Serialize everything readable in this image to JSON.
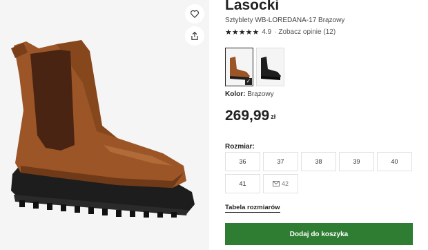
{
  "product": {
    "brand": "Lasocki",
    "name": "Sztyblety WB-LOREDANA-17 Brązowy",
    "rating_stars": "★★★★★",
    "rating_value": "4.9",
    "reviews_link": "· Zobacz opinie (12)",
    "color_label": "Kolor:",
    "color_value": "Brązowy",
    "price": "269,99",
    "currency": "zł"
  },
  "variants": [
    {
      "name": "brown",
      "selected": true,
      "check": "✓"
    },
    {
      "name": "black",
      "selected": false
    }
  ],
  "sizes": {
    "label": "Rozmiar:",
    "options": [
      "36",
      "37",
      "38",
      "39",
      "40",
      "41",
      "42"
    ],
    "notify_icon": "mail-icon"
  },
  "links": {
    "size_table": "Tabela rozmiarów"
  },
  "actions": {
    "add_to_cart": "Dodaj do koszyka"
  },
  "colors": {
    "accent_green": "#2e7d32",
    "boot_brown": "#8b4a22"
  }
}
